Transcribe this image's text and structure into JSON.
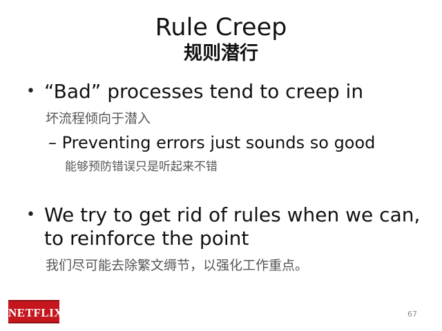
{
  "slide": {
    "title": "Rule Creep",
    "subtitle": "规则潜行",
    "bullets": [
      {
        "text": "“Bad” processes tend to creep in",
        "translation": "坏流程倾向于潜入",
        "sub": {
          "text": "– Preventing errors just sounds so good",
          "translation": "能够预防错误只是听起来不错"
        }
      },
      {
        "line1": "We try to get rid of rules when we can,",
        "line2": "to reinforce the point",
        "translation": "我们尽可能去除繁文缛节，以强化工作重点。"
      }
    ],
    "bullet_symbol": "•",
    "logo_text": "NETFLIX",
    "page_number": "67"
  },
  "colors": {
    "logo_red": "#c4161c",
    "text": "#111111",
    "translation_gray": "#555555"
  }
}
